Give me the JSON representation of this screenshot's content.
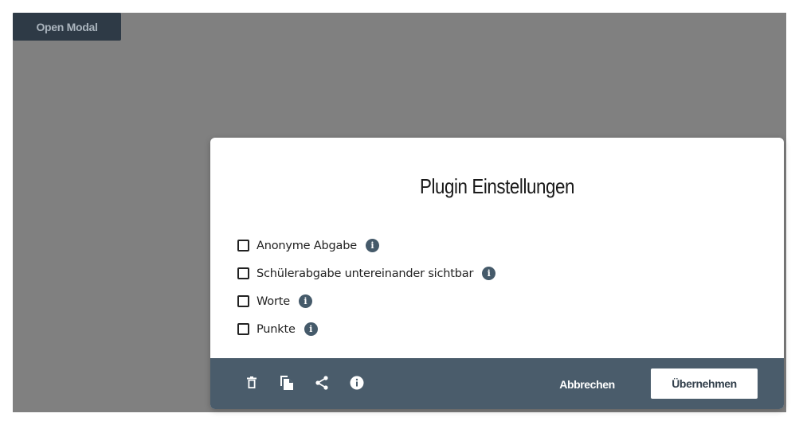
{
  "open_button": {
    "label": "Open Modal"
  },
  "modal": {
    "title": "Plugin Einstellungen",
    "options": [
      {
        "label": "Anonyme Abgabe",
        "checked": false
      },
      {
        "label": "Schülerabgabe untereinander sichtbar",
        "checked": false
      },
      {
        "label": "Worte",
        "checked": false
      },
      {
        "label": "Punkte",
        "checked": false
      }
    ],
    "info_icon_glyph": "i",
    "footer": {
      "icons": [
        "trash-icon",
        "copy-icon",
        "share-icon",
        "info-icon"
      ],
      "cancel_label": "Abbrechen",
      "apply_label": "Übernehmen"
    }
  },
  "colors": {
    "backdrop": "#808080",
    "footer": "#4a5c6b",
    "info_icon": "#455a6a",
    "open_button_bg": "#2e3a46"
  }
}
